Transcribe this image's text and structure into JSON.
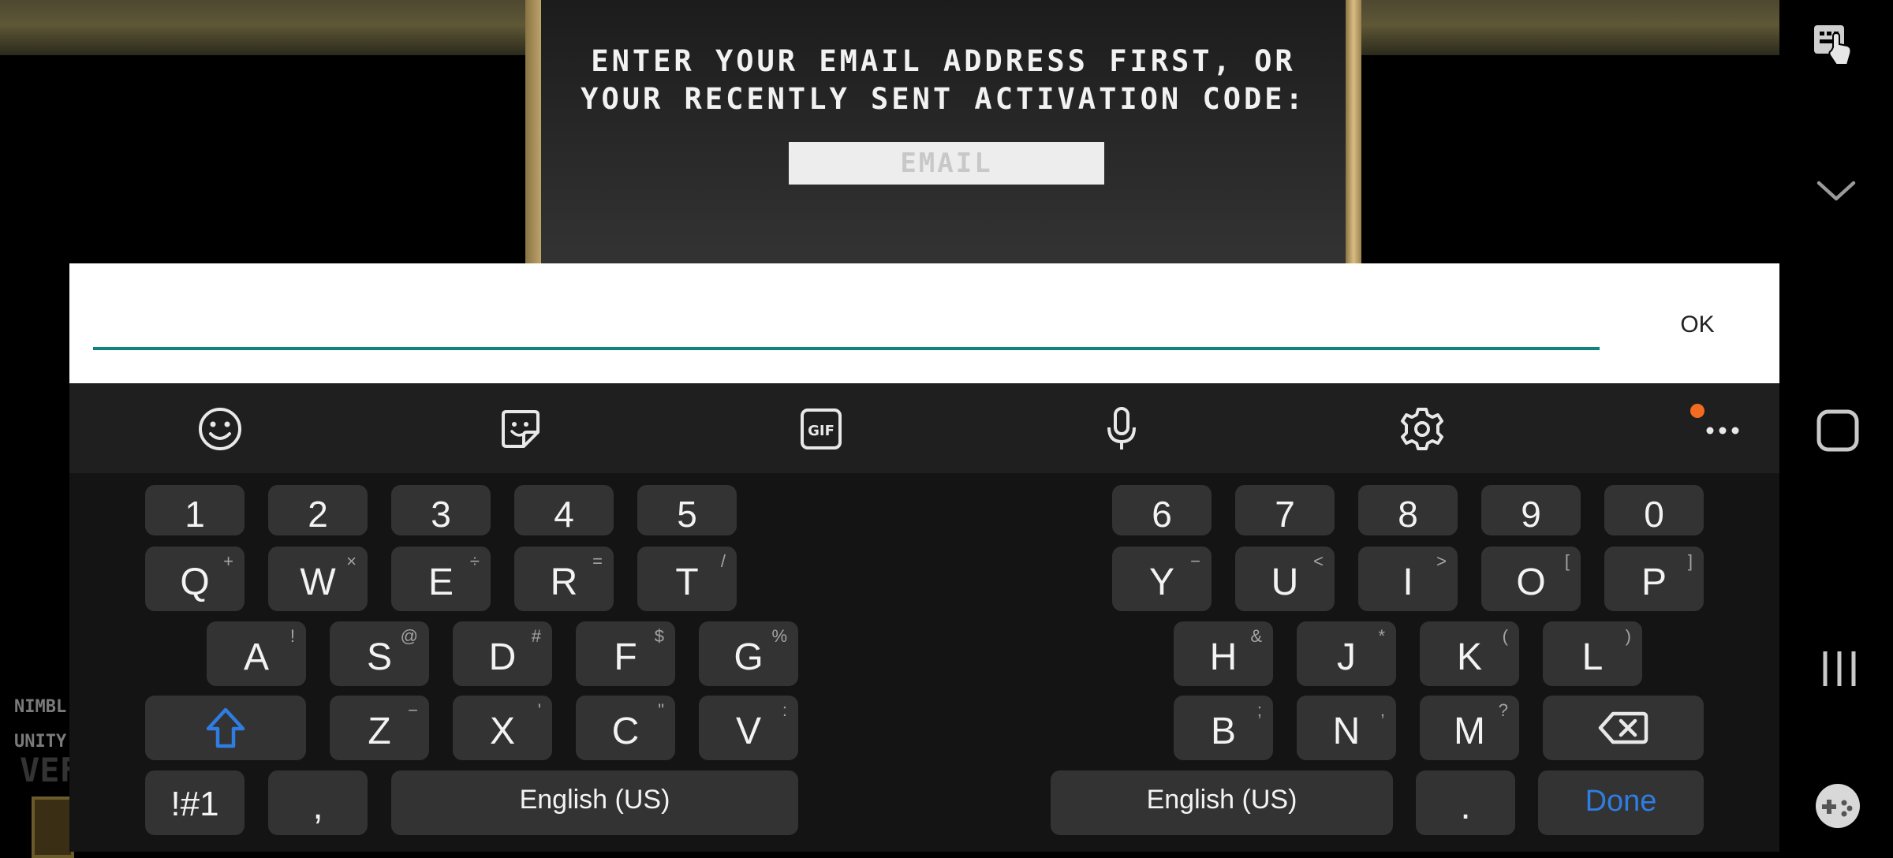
{
  "game": {
    "prompt_line1": "ENTER YOUR EMAIL ADDRESS FIRST, OR",
    "prompt_line2": "YOUR RECENTLY SENT ACTIVATION CODE:",
    "email_placeholder": "EMAIL",
    "bottom_left_line1": "NIMBL",
    "bottom_left_line2": "UNITY",
    "bottom_left_big": "VEF"
  },
  "input_bar": {
    "value": "",
    "ok_label": "OK",
    "accent_color": "#12837a"
  },
  "toolbar": {
    "icons": [
      "emoji-icon",
      "sticker-icon",
      "gif-icon",
      "microphone-icon",
      "settings-icon",
      "more-icon"
    ],
    "gif_label": "GIF",
    "notification_color": "#f26b21"
  },
  "keyboard": {
    "number_row_left": [
      "1",
      "2",
      "3",
      "4",
      "5"
    ],
    "number_row_right": [
      "6",
      "7",
      "8",
      "9",
      "0"
    ],
    "row1_left": [
      {
        "key": "Q",
        "alt": "+"
      },
      {
        "key": "W",
        "alt": "×"
      },
      {
        "key": "E",
        "alt": "÷"
      },
      {
        "key": "R",
        "alt": "="
      },
      {
        "key": "T",
        "alt": "/"
      }
    ],
    "row1_right": [
      {
        "key": "Y",
        "alt": "−"
      },
      {
        "key": "U",
        "alt": "<"
      },
      {
        "key": "I",
        "alt": ">"
      },
      {
        "key": "O",
        "alt": "["
      },
      {
        "key": "P",
        "alt": "]"
      }
    ],
    "row2_left": [
      {
        "key": "A",
        "alt": "!"
      },
      {
        "key": "S",
        "alt": "@"
      },
      {
        "key": "D",
        "alt": "#"
      },
      {
        "key": "F",
        "alt": "$"
      },
      {
        "key": "G",
        "alt": "%"
      }
    ],
    "row2_right": [
      {
        "key": "H",
        "alt": "&"
      },
      {
        "key": "J",
        "alt": "*"
      },
      {
        "key": "K",
        "alt": "("
      },
      {
        "key": "L",
        "alt": ")"
      }
    ],
    "row3_left": [
      {
        "key": "Z",
        "alt": "−"
      },
      {
        "key": "X",
        "alt": "'"
      },
      {
        "key": "C",
        "alt": "\""
      },
      {
        "key": "V",
        "alt": ":"
      }
    ],
    "row3_right": [
      {
        "key": "B",
        "alt": ";"
      },
      {
        "key": "N",
        "alt": ","
      },
      {
        "key": "M",
        "alt": "?"
      }
    ],
    "symbols_label": "!#1",
    "comma_label": ",",
    "space_left_label": "English (US)",
    "space_right_label": "English (US)",
    "period_label": ".",
    "done_label": "Done",
    "accent_color": "#2f7de1"
  },
  "navigation": {
    "icons": [
      "keyboard-icon",
      "chevron-down-icon",
      "home-icon",
      "recents-icon",
      "gamepad-icon"
    ]
  }
}
